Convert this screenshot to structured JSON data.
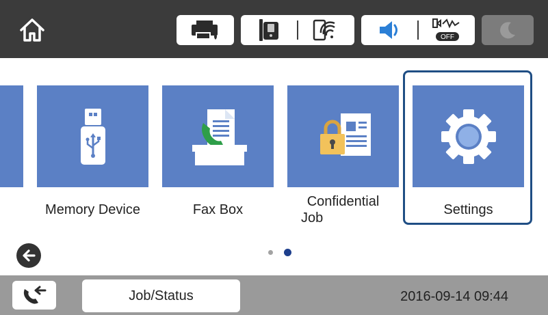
{
  "topbar": {
    "icons": [
      "home-icon",
      "printer-ink-icon",
      "fax-line-icon",
      "wifi-icon",
      "speaker-icon",
      "quiet-mode-icon",
      "sleep-moon-icon"
    ],
    "quiet_badge": "OFF",
    "colors": {
      "bar": "#3b3b3b",
      "pill": "#ffffff",
      "sleep_pill": "#7c7c7c"
    }
  },
  "tiles": [
    {
      "label": "Memory Device",
      "icon": "usb-drive-icon"
    },
    {
      "label": "Fax Box",
      "icon": "fax-box-icon"
    },
    {
      "label": "Confidential",
      "label_line2": "Job",
      "icon": "confidential-job-icon"
    },
    {
      "label": "Settings",
      "icon": "gear-icon"
    }
  ],
  "tile_color": "#5b80c5",
  "selection_color": "#1f4e84",
  "pagination": {
    "pages": 2,
    "current": 2
  },
  "bottombar": {
    "job_status_label": "Job/Status",
    "datetime": "2016-09-14 09:44"
  }
}
